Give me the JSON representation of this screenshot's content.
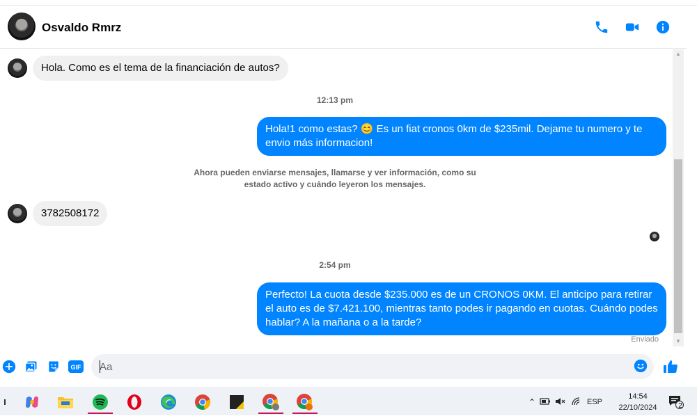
{
  "header": {
    "contact_name": "Osvaldo Rmrz",
    "icons": [
      "phone-icon",
      "video-camera-icon",
      "info-icon"
    ]
  },
  "messages": [
    {
      "id": "m1",
      "direction": "in",
      "text": "Hola. Como es el tema de la financiación de autos?"
    },
    {
      "id": "t1",
      "type": "timestamp",
      "text": "12:13 pm"
    },
    {
      "id": "m2",
      "direction": "out",
      "text": "Hola!1 como estas? 😊 Es un fiat cronos 0km de $235mil. Dejame tu numero y te envio más informacion!"
    },
    {
      "id": "n1",
      "type": "notice",
      "text": "Ahora pueden enviarse mensajes, llamarse y ver información, como su estado activo y cuándo leyeron los mensajes."
    },
    {
      "id": "m3",
      "direction": "in",
      "text": "3782508172"
    },
    {
      "id": "t2",
      "type": "timestamp",
      "text": "2:54 pm"
    },
    {
      "id": "m4",
      "direction": "out",
      "text": "Perfecto! La cuota desde $235.000 es de un CRONOS 0KM. El anticipo para retirar el auto es de $7.421.100, mientras tanto podes ir pagando en cuotas. Cuándo podes hablar? A la mañana o a la tarde?"
    }
  ],
  "status": {
    "delivery": "Enviado"
  },
  "composer": {
    "placeholder": "Aa",
    "icons": [
      "plus-icon",
      "photo-icon",
      "sticker-icon",
      "gif-icon",
      "emoji-icon",
      "like-icon"
    ],
    "gif_label": "GIF"
  },
  "taskbar": {
    "apps": [
      "copilot",
      "file-explorer",
      "spotify",
      "opera",
      "edge",
      "chrome",
      "sticky-notes",
      "chrome-profile",
      "chrome-profile-2"
    ],
    "language": "ESP",
    "time": "14:54",
    "date": "22/10/2024",
    "notification_count": "2"
  },
  "colors": {
    "accent": "#0084ff",
    "incoming_bubble": "#f0f0f0"
  }
}
